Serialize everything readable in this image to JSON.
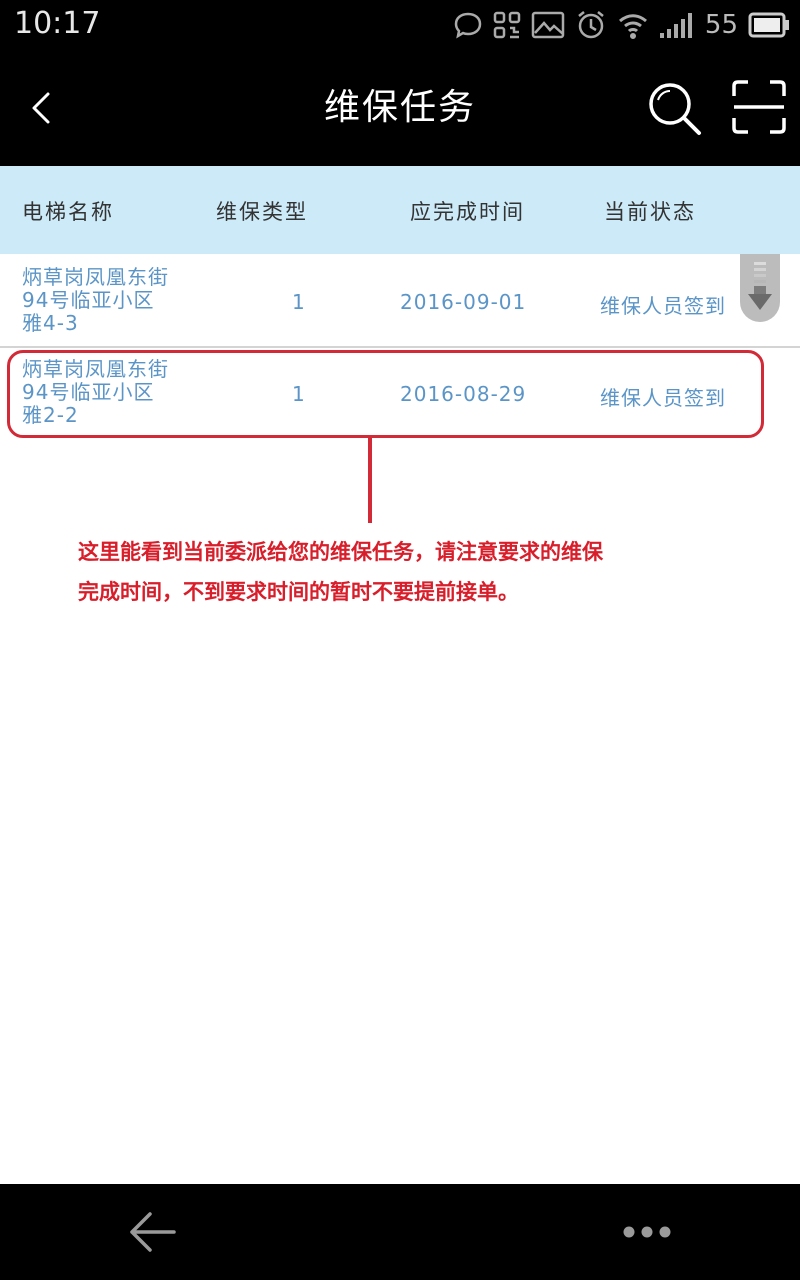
{
  "status_bar": {
    "time": "10:17",
    "battery_level": "55",
    "icons": [
      "chat-icon",
      "qr-icon",
      "image-icon",
      "alarm-icon",
      "wifi-icon",
      "signal-icon",
      "battery-icon"
    ]
  },
  "header": {
    "title": "维保任务",
    "icons": [
      "back-icon",
      "search-icon",
      "scan-icon"
    ]
  },
  "table": {
    "columns": [
      "电梯名称",
      "维保类型",
      "应完成时间",
      "当前状态"
    ],
    "rows": [
      {
        "name_lines": [
          "炳草岗凤凰东街",
          "94号临亚小区",
          "雅4-3"
        ],
        "type": "1",
        "date": "2016-09-01",
        "status": "维保人员签到"
      },
      {
        "name_lines": [
          "炳草岗凤凰东街",
          "94号临亚小区",
          "雅2-2"
        ],
        "type": "1",
        "date": "2016-08-29",
        "status": "维保人员签到"
      }
    ]
  },
  "annotation": {
    "lines": [
      "这里能看到当前委派给您的维保任务，请注意要求的维保",
      "完成时间，不到要求时间的暂时不要提前接单。"
    ]
  },
  "bottom_nav": {
    "icons": [
      "nav-back-icon",
      "more-icon"
    ]
  },
  "colors": {
    "header_bg": "#000000",
    "table_header_bg": "#cdeaf8",
    "row_text": "#5b95c7",
    "annotation": "#d81e2a"
  }
}
